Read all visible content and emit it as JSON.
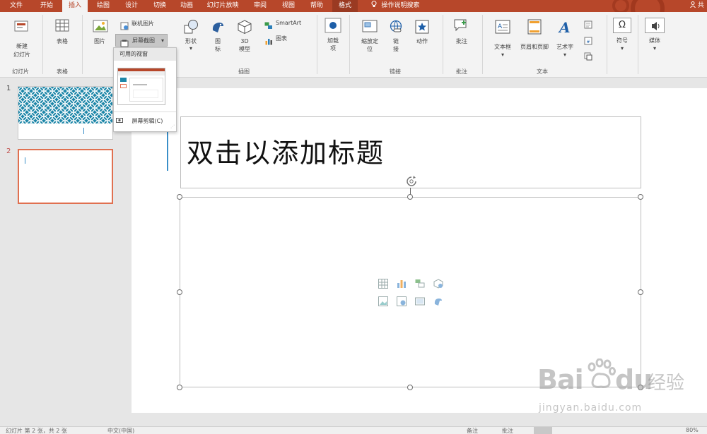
{
  "tabs": [
    {
      "label": "文件"
    },
    {
      "label": "开始"
    },
    {
      "label": "插入"
    },
    {
      "label": "绘图"
    },
    {
      "label": "设计"
    },
    {
      "label": "切换"
    },
    {
      "label": "动画"
    },
    {
      "label": "幻灯片放映"
    },
    {
      "label": "审阅"
    },
    {
      "label": "视图"
    },
    {
      "label": "帮助"
    },
    {
      "label": "格式"
    }
  ],
  "tell_me": "操作说明搜索",
  "share": "共",
  "ribbon": {
    "new_slide": "新建",
    "new_slide2": "幻灯片",
    "group_slides": "幻灯片",
    "table": "表格",
    "group_tables": "表格",
    "picture": "图片",
    "online_picture": "联机图片",
    "screenshot": "屏幕截图",
    "shapes": "形状",
    "icons": "图",
    "icons2": "标",
    "model3d": "3D",
    "model3d2": "模型",
    "smartart": "SmartArt",
    "chart": "图表",
    "group_illustrations": "插图",
    "addins": "加载",
    "addins2": "项",
    "zoom": "缩放定",
    "zoom2": "位",
    "link": "链",
    "link2": "接",
    "action": "动作",
    "group_links": "链接",
    "comment": "批注",
    "group_comments": "批注",
    "textbox": "文本框",
    "header_footer": "页眉和页脚",
    "wordart": "艺术字",
    "group_text": "文本",
    "symbols": "符号",
    "media": "媒体"
  },
  "dropdown": {
    "header": "可用的视窗",
    "screen_clipping": "屏幕剪辑(C)"
  },
  "thumbnails": [
    {
      "num": "1"
    },
    {
      "num": "2"
    }
  ],
  "slide": {
    "title_placeholder": "双击以添加标题"
  },
  "statusbar": {
    "left": "幻灯片 第 2 张，共 2 张",
    "lang": "中文(中国)",
    "notes": "备注",
    "comments": "批注",
    "zoom": "80%"
  },
  "watermark": {
    "brand": "Bai",
    "brand2": "du",
    "brand3": "经验",
    "url": "jingyan.baidu.com"
  },
  "colors": {
    "accent": "#b7472a",
    "selected_thumb": "#e07050",
    "pattern_teal": "#1d86a8"
  }
}
